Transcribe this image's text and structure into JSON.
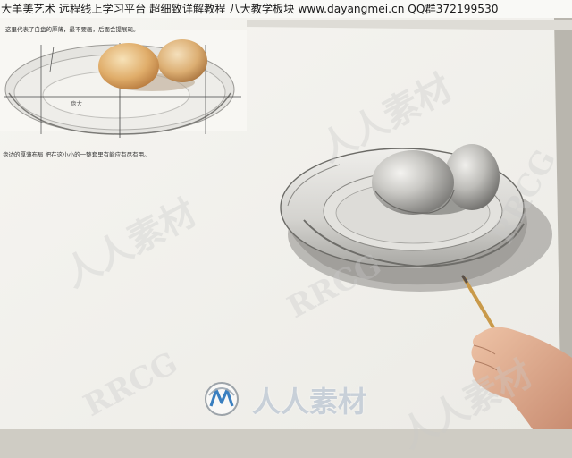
{
  "header": {
    "banner_text": "大羊美艺术  远程线上学习平台  超细致详解教程  八大教学板块 www.dayangmei.cn QQ群372199530"
  },
  "reference_photo": {
    "top_note": "这里代表了白盘的厚薄，最不要画，后面会提展现。",
    "bottom_note": "盘边的厚薄布局    把在这小小的一整套里有能应有尽有用。",
    "plate_label": "盘大"
  },
  "watermarks": {
    "chinese": "人人素材",
    "latin": "RRCG"
  },
  "logo": {
    "text": "人人素材",
    "icon": "rrcg-logo-icon"
  },
  "colors": {
    "paper": "#f4f3ef",
    "background": "#cfccc4",
    "banner_background": "#fafaf8",
    "pencil_wood": "#c99a4a",
    "skin": "#e2b49a",
    "logo_accent": "#3a7fc0"
  }
}
